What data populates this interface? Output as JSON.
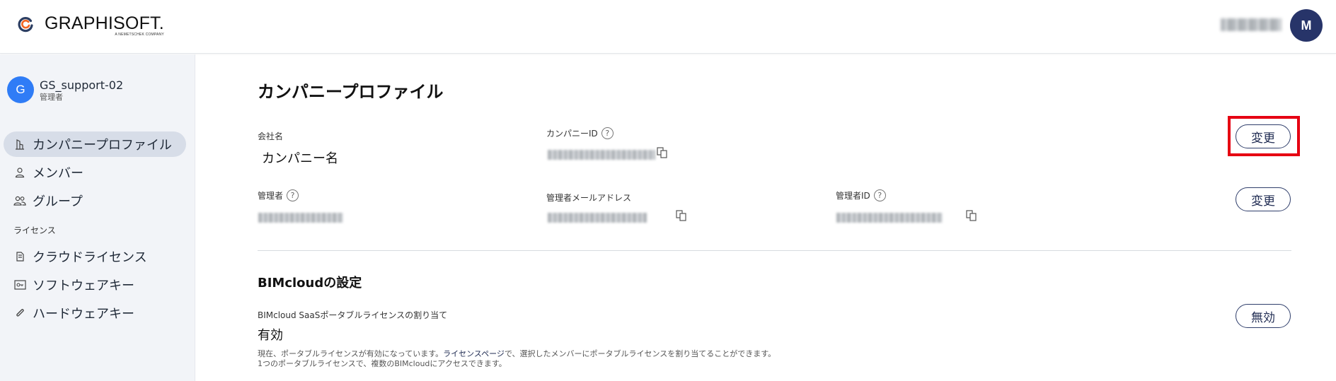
{
  "header": {
    "logo_name": "GRAPHISOFT.",
    "logo_sub": "A NEMETSCHEK COMPANY",
    "user_avatar_initial": "M"
  },
  "sidebar": {
    "org_initial": "G",
    "org_name": "GS_support-02",
    "org_role": "管理者",
    "items": [
      {
        "label": "カンパニープロファイル",
        "icon": "building-icon",
        "active": true
      },
      {
        "label": "メンバー",
        "icon": "person-icon"
      },
      {
        "label": "グループ",
        "icon": "group-icon"
      }
    ],
    "license_section": "ライセンス",
    "license_items": [
      {
        "label": "クラウドライセンス",
        "icon": "document-icon"
      },
      {
        "label": "ソフトウェアキー",
        "icon": "key-icon"
      },
      {
        "label": "ハードウェアキー",
        "icon": "paperclip-icon"
      }
    ]
  },
  "profile": {
    "title": "カンパニープロファイル",
    "company_name_label": "会社名",
    "company_name": "カンパニー名",
    "company_id_label": "カンパニーID",
    "admin_label": "管理者",
    "admin_email_label": "管理者メールアドレス",
    "admin_id_label": "管理者ID",
    "change_button": "変更",
    "change_button_2": "変更"
  },
  "bimcloud": {
    "title": "BIMcloudの設定",
    "portable_label": "BIMcloud SaaSポータブルライセンスの割り当て",
    "portable_value": "有効",
    "disable_button": "無効",
    "desc_line1_before": "現在、ポータブルライセンスが有効になっています。",
    "desc_link": "ライセンスページ",
    "desc_line1_after": "で、選択したメンバーにポータブルライセンスを割り当てることができます。",
    "desc_line2": "1つのポータブルライセンスで、複数のBIMcloudにアクセスできます。"
  },
  "colors": {
    "accent_navy": "#273469",
    "highlight_red": "#e60012",
    "org_blue": "#2f7cf6",
    "sidebar_bg": "#f2f4f8",
    "active_item_bg": "#d7dde8"
  }
}
